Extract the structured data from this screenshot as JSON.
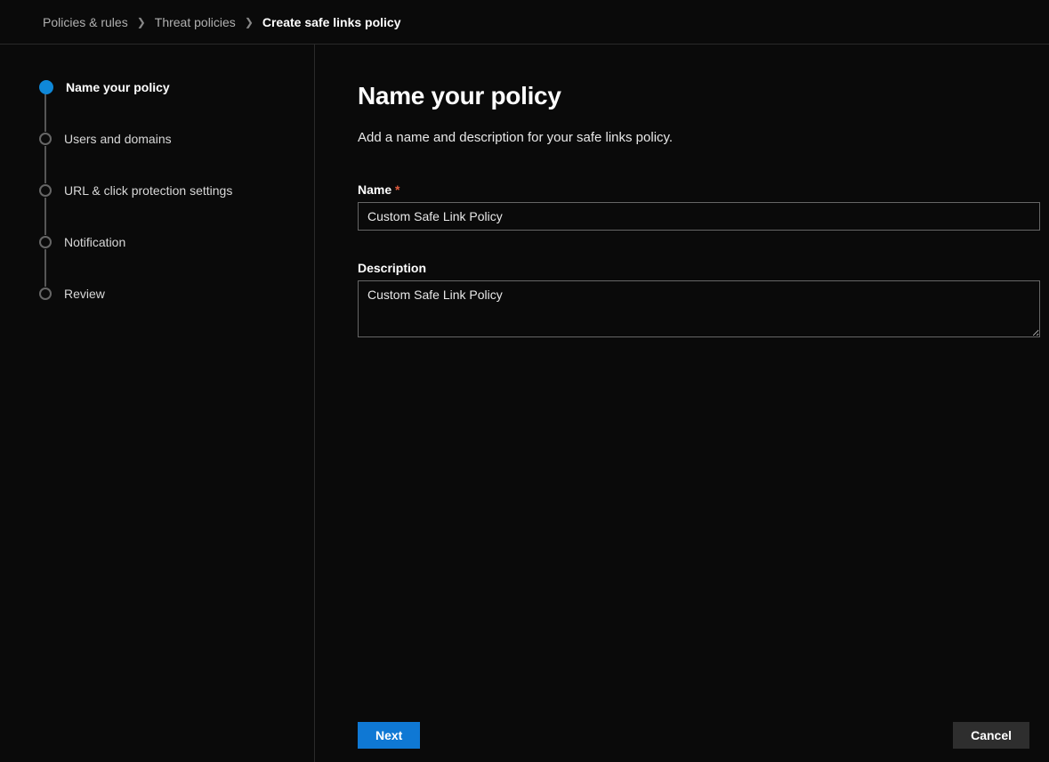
{
  "breadcrumb": {
    "items": [
      {
        "label": "Policies & rules"
      },
      {
        "label": "Threat policies"
      },
      {
        "label": "Create safe links policy",
        "current": true
      }
    ]
  },
  "stepper": {
    "steps": [
      {
        "label": "Name your policy",
        "active": true
      },
      {
        "label": "Users and domains",
        "active": false
      },
      {
        "label": "URL & click protection settings",
        "active": false
      },
      {
        "label": "Notification",
        "active": false
      },
      {
        "label": "Review",
        "active": false
      }
    ]
  },
  "main": {
    "title": "Name your policy",
    "subtitle": "Add a name and description for your safe links policy.",
    "name_label": "Name",
    "name_required_marker": "*",
    "name_value": "Custom Safe Link Policy",
    "description_label": "Description",
    "description_value": "Custom Safe Link Policy"
  },
  "footer": {
    "next_label": "Next",
    "cancel_label": "Cancel"
  }
}
